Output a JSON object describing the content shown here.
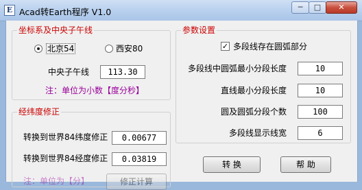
{
  "window": {
    "icon_letter": "E",
    "title": "Acad转Earth程序 V1.0",
    "min_glyph": "─",
    "max_glyph": "□",
    "close_glyph": "✕"
  },
  "coord": {
    "legend": "坐标系及中央子午线",
    "beijing_label": "北京54",
    "xian_label": "西安80",
    "selected": "北京54",
    "meridian_label": "中央子午线",
    "meridian_value": "113.30",
    "note": "注：单位为小数【度分秒】"
  },
  "latlon": {
    "legend": "经纬度修正",
    "lat_label": "转换到世界84纬度修正",
    "lat_value": "0.00677",
    "lon_label": "转换到世界84经度修正",
    "lon_value": "0.03819",
    "partial_note": "注：单位为【分】",
    "partial_button": "修正计算"
  },
  "params": {
    "legend": "参数设置",
    "arc_checkbox_label": "多段线存在圆弧部分",
    "arc_checked": true,
    "check_glyph": "✓",
    "seg_arc_label": "多段线中圆弧最小分段长度",
    "seg_arc_value": "10",
    "line_min_label": "直线最小分段长度",
    "line_min_value": "10",
    "circle_seg_label": "圆及圆弧分段个数",
    "circle_seg_value": "100",
    "width_label": "多段线显示线宽",
    "width_value": "6"
  },
  "buttons": {
    "convert": "转 换",
    "help": "帮 助"
  }
}
